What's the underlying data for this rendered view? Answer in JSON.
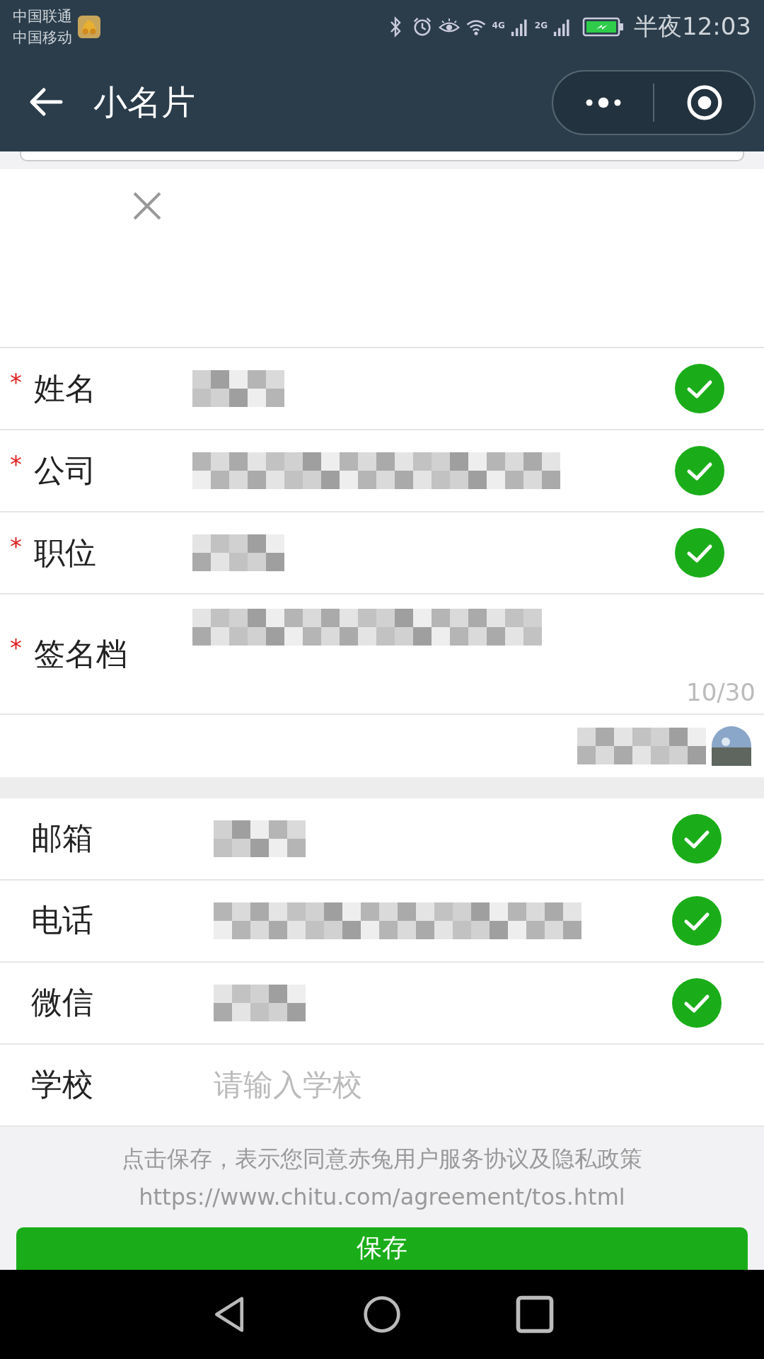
{
  "status_bar": {
    "carriers": [
      "中国联通",
      "中国移动"
    ],
    "time": "半夜12:03",
    "network_1": "4G",
    "network_2": "2G"
  },
  "header": {
    "title": "小名片"
  },
  "required_fields": [
    {
      "label": "姓名",
      "required_mark": "*",
      "blurred": true,
      "checked": true
    },
    {
      "label": "公司",
      "required_mark": "*",
      "blurred": true,
      "checked": true
    },
    {
      "label": "职位",
      "required_mark": "*",
      "blurred": true,
      "checked": true
    }
  ],
  "signature": {
    "label": "签名档",
    "required_mark": "*",
    "blurred": true,
    "counter": "10/30"
  },
  "signature_source": {
    "blurred": true
  },
  "optional_fields": [
    {
      "label": "邮箱",
      "blurred": true,
      "checked": true
    },
    {
      "label": "电话",
      "blurred": true,
      "checked": true
    },
    {
      "label": "微信",
      "blurred": true,
      "checked": true
    },
    {
      "label": "学校",
      "placeholder": "请输入学校",
      "checked": false
    }
  ],
  "agreement": {
    "text": "点击保存，表示您同意赤兔用户服务协议及隐私政策",
    "url": "https://www.chitu.com/agreement/tos.html"
  },
  "save_button": {
    "label": "保存"
  }
}
